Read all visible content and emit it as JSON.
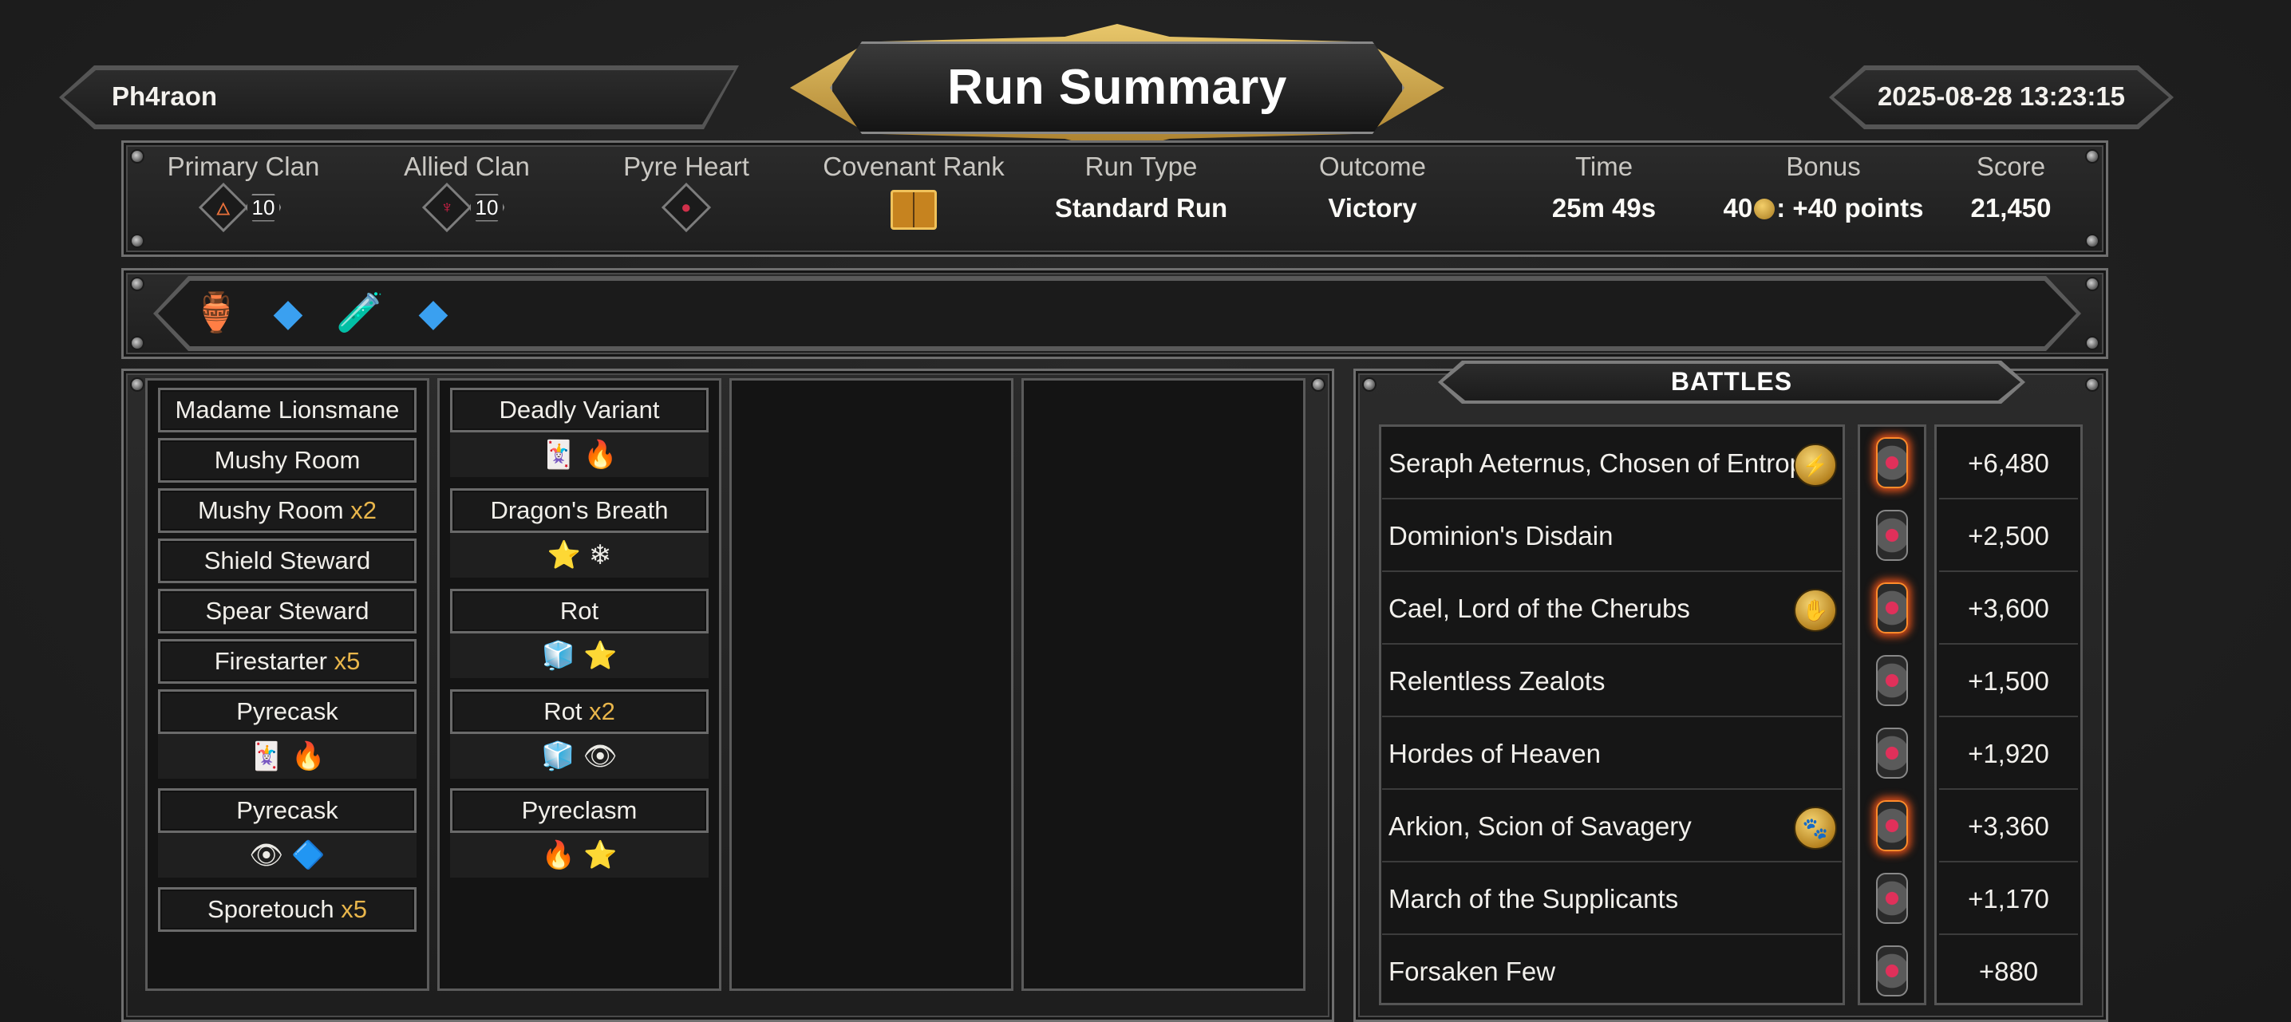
{
  "header": {
    "player_name": "Ph4raon",
    "title": "Run Summary",
    "datetime": "2025-08-28 13:23:15"
  },
  "stats": {
    "primary_clan": {
      "label": "Primary Clan",
      "level": "10",
      "icon": "primary-clan-emblem"
    },
    "allied_clan": {
      "label": "Allied Clan",
      "level": "10",
      "icon": "allied-clan-emblem"
    },
    "pyre_heart": {
      "label": "Pyre Heart",
      "icon": "pyre-heart-icon"
    },
    "covenant_rank": {
      "label": "Covenant Rank",
      "icon": "covenant-book-icon"
    },
    "run_type": {
      "label": "Run Type",
      "value": "Standard Run"
    },
    "outcome": {
      "label": "Outcome",
      "value": "Victory"
    },
    "time": {
      "label": "Time",
      "value": "25m 49s"
    },
    "bonus": {
      "label": "Bonus",
      "value_prefix": "40",
      "value_suffix": ": +40 points"
    },
    "score": {
      "label": "Score",
      "value": "21,450"
    }
  },
  "artifacts": [
    {
      "icon": "artifact-shrine-icon",
      "glyph": "🏺"
    },
    {
      "icon": "artifact-blue-shard-icon",
      "glyph": "💎"
    },
    {
      "icon": "artifact-potion-icon",
      "glyph": "🧪"
    },
    {
      "icon": "artifact-blue-shard-icon",
      "glyph": "💎"
    }
  ],
  "deck": {
    "column1": [
      {
        "name": "Madame Lionsmane",
        "mult": ""
      },
      {
        "name": "Mushy Room",
        "mult": ""
      },
      {
        "name": "Mushy Room",
        "mult": "x2"
      },
      {
        "name": "Shield Steward",
        "mult": ""
      },
      {
        "name": "Spear Steward",
        "mult": ""
      },
      {
        "name": "Firestarter",
        "mult": "x5"
      },
      {
        "name": "Pyrecask",
        "mult": "",
        "upgrades": [
          "🃏",
          "🔥"
        ]
      },
      {
        "name": "Pyrecask",
        "mult": "",
        "upgrades": [
          "👁",
          "🔷"
        ]
      },
      {
        "name": "Sporetouch",
        "mult": "x5"
      }
    ],
    "column2": [
      {
        "name": "Deadly Variant",
        "mult": "",
        "upgrades": [
          "🃏",
          "🔥"
        ]
      },
      {
        "name": "Dragon's Breath",
        "mult": "",
        "upgrades": [
          "⭐",
          "❄"
        ]
      },
      {
        "name": "Rot",
        "mult": "",
        "upgrades": [
          "🧊",
          "⭐"
        ]
      },
      {
        "name": "Rot",
        "mult": "x2",
        "upgrades": [
          "🧊",
          "👁"
        ]
      },
      {
        "name": "Pyreclasm",
        "mult": "",
        "upgrades": [
          "🔥",
          "⭐"
        ]
      }
    ]
  },
  "battles": {
    "header": "BATTLES",
    "rows": [
      {
        "name": "Seraph Aeternus, Chosen of Entropy",
        "score": "+6,480",
        "boss_medal": true,
        "lit": true
      },
      {
        "name": "Dominion's Disdain",
        "score": "+2,500",
        "boss_medal": false,
        "lit": false
      },
      {
        "name": "Cael, Lord of the Cherubs",
        "score": "+3,600",
        "boss_medal": true,
        "lit": true
      },
      {
        "name": "Relentless Zealots",
        "score": "+1,500",
        "boss_medal": false,
        "lit": false
      },
      {
        "name": "Hordes of Heaven",
        "score": "+1,920",
        "boss_medal": false,
        "lit": false
      },
      {
        "name": "Arkion, Scion of Savagery",
        "score": "+3,360",
        "boss_medal": true,
        "lit": true
      },
      {
        "name": "March of the Supplicants",
        "score": "+1,170",
        "boss_medal": false,
        "lit": false
      },
      {
        "name": "Forsaken Few",
        "score": "+880",
        "boss_medal": false,
        "lit": false
      }
    ]
  }
}
